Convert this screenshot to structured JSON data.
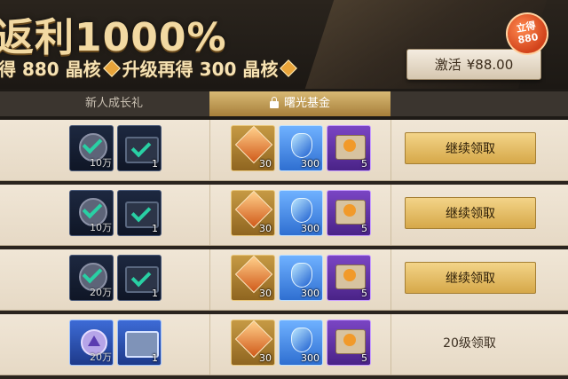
{
  "header": {
    "title": "返利1000%",
    "subtitle_part1": "得 880 晶核",
    "subtitle_part2": "升级再得 300 晶核",
    "activate_label": "激活",
    "price": "¥88.00",
    "badge_line1": "立得",
    "badge_line2": "880"
  },
  "tabs": [
    {
      "label": "新人成长礼",
      "active": false
    },
    {
      "label": "曙光基金",
      "active": true
    }
  ],
  "rows": [
    {
      "left_items": [
        {
          "icon": "check-coin-icon",
          "qty": "10万"
        },
        {
          "icon": "check-chest-icon",
          "qty": "1"
        }
      ],
      "rewards": [
        {
          "icon": "amber-crystal-icon",
          "qty": "30"
        },
        {
          "icon": "sapphire-icon",
          "qty": "300"
        },
        {
          "icon": "paw-scroll-icon",
          "qty": "5"
        }
      ],
      "action": "继续领取",
      "action_type": "button"
    },
    {
      "left_items": [
        {
          "icon": "check-coin-icon",
          "qty": "10万"
        },
        {
          "icon": "check-chest-icon",
          "qty": "1"
        }
      ],
      "rewards": [
        {
          "icon": "amber-crystal-icon",
          "qty": "30"
        },
        {
          "icon": "sapphire-icon",
          "qty": "300"
        },
        {
          "icon": "paw-scroll-icon",
          "qty": "5"
        }
      ],
      "action": "继续领取",
      "action_type": "button"
    },
    {
      "left_items": [
        {
          "icon": "check-coin-icon",
          "qty": "20万"
        },
        {
          "icon": "check-chest-icon",
          "qty": "1"
        }
      ],
      "rewards": [
        {
          "icon": "amber-crystal-icon",
          "qty": "30"
        },
        {
          "icon": "sapphire-icon",
          "qty": "300"
        },
        {
          "icon": "paw-scroll-icon",
          "qty": "5"
        }
      ],
      "action": "继续领取",
      "action_type": "button"
    },
    {
      "left_items": [
        {
          "icon": "triangle-coin-icon",
          "qty": "20万"
        },
        {
          "icon": "steel-chest-icon",
          "qty": "1"
        }
      ],
      "rewards": [
        {
          "icon": "amber-crystal-icon",
          "qty": "30"
        },
        {
          "icon": "sapphire-icon",
          "qty": "300"
        },
        {
          "icon": "paw-scroll-icon",
          "qty": "5"
        }
      ],
      "action": "20级领取",
      "action_type": "text"
    }
  ]
}
